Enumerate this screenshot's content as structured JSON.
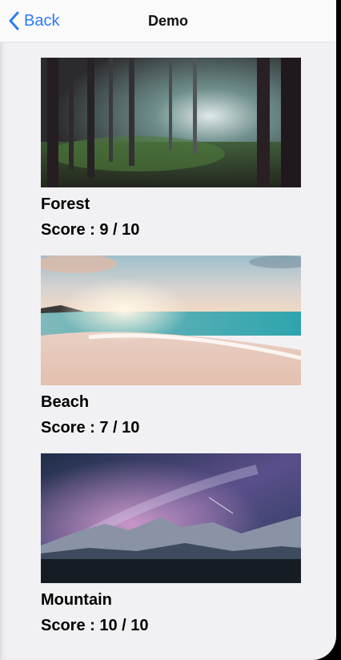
{
  "navbar": {
    "back_label": "Back",
    "title": "Demo"
  },
  "items": [
    {
      "name": "Forest",
      "score": "Score : 9 / 10"
    },
    {
      "name": "Beach",
      "score": "Score : 7 / 10"
    },
    {
      "name": "Mountain",
      "score": "Score : 10 / 10"
    }
  ],
  "colors": {
    "accent": "#2d7bf4",
    "background": "#f1f1f3"
  }
}
